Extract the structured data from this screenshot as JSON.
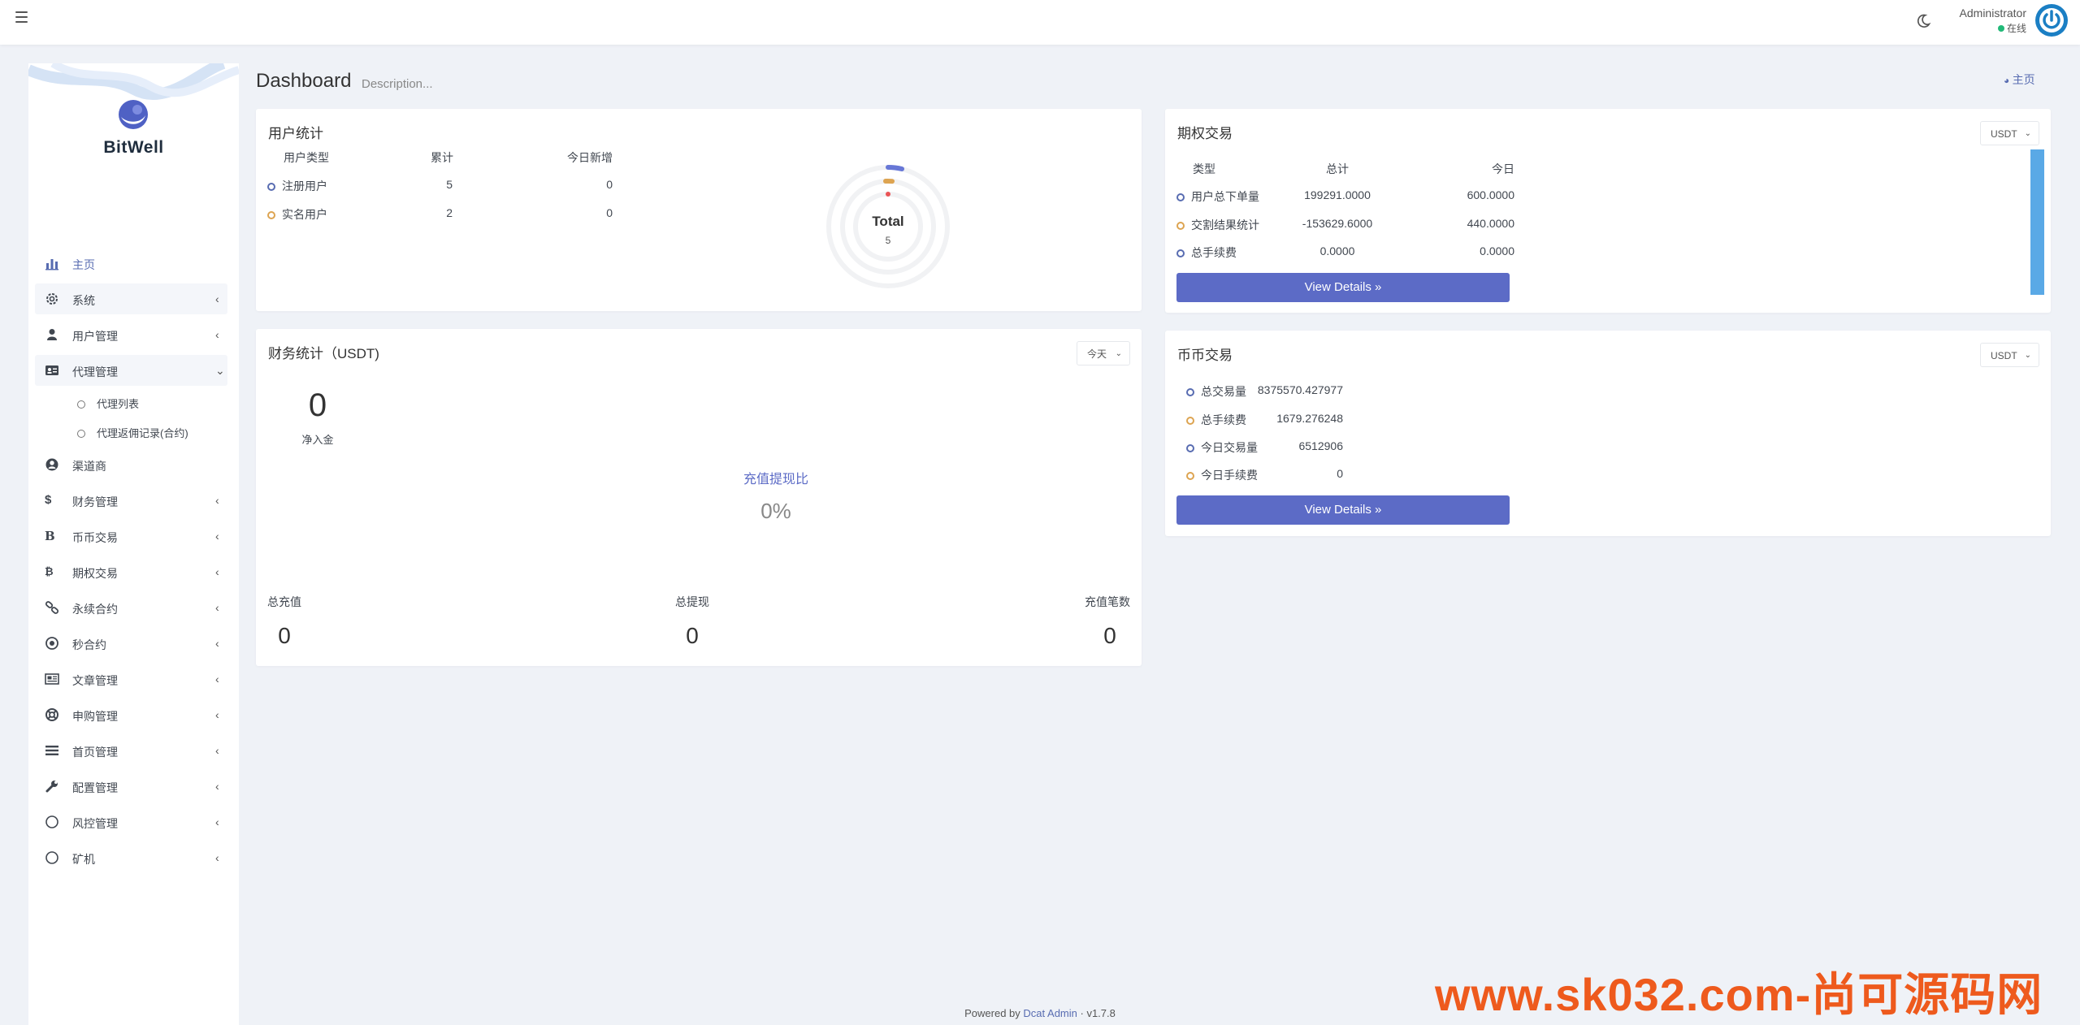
{
  "header": {
    "user_name": "Administrator",
    "user_status": "在线"
  },
  "sidebar": {
    "brand": "BitWell",
    "items": [
      {
        "label": "主页",
        "icon": "bar-chart-icon"
      },
      {
        "label": "系统",
        "icon": "gear-icon"
      },
      {
        "label": "用户管理",
        "icon": "user-icon"
      },
      {
        "label": "代理管理",
        "icon": "id-card-icon"
      },
      {
        "label": "渠道商",
        "icon": "user-circle-icon"
      },
      {
        "label": "财务管理",
        "icon": "dollar-icon"
      },
      {
        "label": "币币交易",
        "icon": "bitcoin-icon"
      },
      {
        "label": "期权交易",
        "icon": "bitcoin-coin-icon"
      },
      {
        "label": "永续合约",
        "icon": "link-icon"
      },
      {
        "label": "秒合约",
        "icon": "dot-circle-icon"
      },
      {
        "label": "文章管理",
        "icon": "newspaper-icon"
      },
      {
        "label": "申购管理",
        "icon": "lifebuoy-icon"
      },
      {
        "label": "首页管理",
        "icon": "bars-icon"
      },
      {
        "label": "配置管理",
        "icon": "wrench-icon"
      },
      {
        "label": "风控管理",
        "icon": "circle-icon"
      },
      {
        "label": "矿机",
        "icon": "circle-icon"
      }
    ],
    "sub_items": [
      "代理列表",
      "代理返佣记录(合约)"
    ]
  },
  "page": {
    "title": "Dashboard",
    "description": "Description...",
    "home_link": "主页"
  },
  "user_stats": {
    "title": "用户统计",
    "headers": [
      "用户类型",
      "累计",
      "今日新增"
    ],
    "rows": [
      {
        "type": "注册用户",
        "total": "5",
        "today": "0",
        "color": "#586cb1"
      },
      {
        "type": "实名用户",
        "total": "2",
        "today": "0",
        "color": "#dda451"
      }
    ],
    "chart_label": "Total",
    "chart_value": "5"
  },
  "finance": {
    "title": "财务统计（USDT)",
    "range": "今天",
    "net_value": "0",
    "net_label": "净入金",
    "ratio_label": "充值提现比",
    "ratio_value": "0%",
    "totals": [
      {
        "label": "总充值",
        "value": "0"
      },
      {
        "label": "总提现",
        "value": "0"
      },
      {
        "label": "充值笔数",
        "value": "0"
      }
    ]
  },
  "options": {
    "title": "期权交易",
    "currency": "USDT",
    "headers": [
      "类型",
      "总计",
      "今日"
    ],
    "rows": [
      {
        "type": "用户总下单量",
        "total": "199291.0000",
        "today": "600.0000",
        "color": "#586cb1"
      },
      {
        "type": "交割结果统计",
        "total": "-153629.6000",
        "today": "440.0000",
        "color": "#dda451"
      },
      {
        "type": "总手续费",
        "total": "0.0000",
        "today": "0.0000",
        "color": "#586cb1"
      }
    ],
    "button": "View Details"
  },
  "spot": {
    "title": "币币交易",
    "currency": "USDT",
    "rows": [
      {
        "label": "总交易量",
        "value": "8375570.427977",
        "color": "#586cb1"
      },
      {
        "label": "总手续费",
        "value": "1679.276248",
        "color": "#dda451"
      },
      {
        "label": "今日交易量",
        "value": "6512906",
        "color": "#586cb1"
      },
      {
        "label": "今日手续费",
        "value": "0",
        "color": "#dda451"
      }
    ],
    "button": "View Details"
  },
  "footer": {
    "prefix": "Powered by",
    "link": "Dcat Admin",
    "version": "v1.7.8"
  },
  "watermark": "www.sk032.com-尚可源码网"
}
